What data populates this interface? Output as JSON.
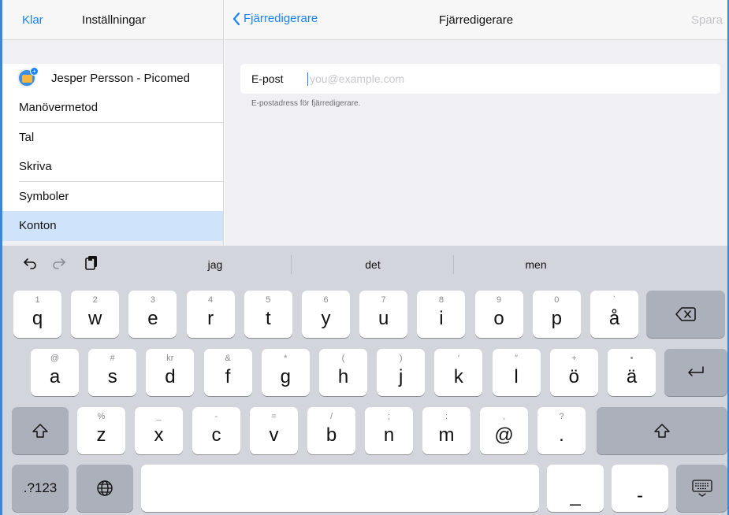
{
  "left": {
    "done": "Klar",
    "title": "Inställningar",
    "account": "Jesper Persson - Picomed",
    "items": [
      "Manövermetod",
      "Tal",
      "Skriva",
      "Symboler",
      "Konton"
    ]
  },
  "right": {
    "back": "Fjärredigerare",
    "title": "Fjärredigerare",
    "save": "Spara",
    "email_label": "E-post",
    "email_placeholder": "you@example.com",
    "email_hint": "E-postadress för fjärredigerare."
  },
  "keyboard": {
    "suggestions": [
      "jag",
      "det",
      "men"
    ],
    "row1": [
      {
        "main": "q",
        "alt": "1"
      },
      {
        "main": "w",
        "alt": "2"
      },
      {
        "main": "e",
        "alt": "3"
      },
      {
        "main": "r",
        "alt": "4"
      },
      {
        "main": "t",
        "alt": "5"
      },
      {
        "main": "y",
        "alt": "6"
      },
      {
        "main": "u",
        "alt": "7"
      },
      {
        "main": "i",
        "alt": "8"
      },
      {
        "main": "o",
        "alt": "9"
      },
      {
        "main": "p",
        "alt": "0"
      },
      {
        "main": "å",
        "alt": "`"
      }
    ],
    "row2": [
      {
        "main": "a",
        "alt": "@"
      },
      {
        "main": "s",
        "alt": "#"
      },
      {
        "main": "d",
        "alt": "kr"
      },
      {
        "main": "f",
        "alt": "&"
      },
      {
        "main": "g",
        "alt": "*"
      },
      {
        "main": "h",
        "alt": "("
      },
      {
        "main": "j",
        "alt": ")"
      },
      {
        "main": "k",
        "alt": "′"
      },
      {
        "main": "l",
        "alt": "″"
      },
      {
        "main": "ö",
        "alt": "+"
      },
      {
        "main": "ä",
        "alt": "•"
      }
    ],
    "row3": [
      {
        "main": "z",
        "alt": "%"
      },
      {
        "main": "x",
        "alt": "_"
      },
      {
        "main": "c",
        "alt": "-"
      },
      {
        "main": "v",
        "alt": "="
      },
      {
        "main": "b",
        "alt": "/"
      },
      {
        "main": "n",
        "alt": ";"
      },
      {
        "main": "m",
        "alt": ":"
      },
      {
        "main": "@",
        "alt": ","
      },
      {
        "main": ".",
        "alt": "?"
      }
    ],
    "numbers_key": ".?123",
    "underscore_key": "_",
    "dash_key": "-"
  }
}
